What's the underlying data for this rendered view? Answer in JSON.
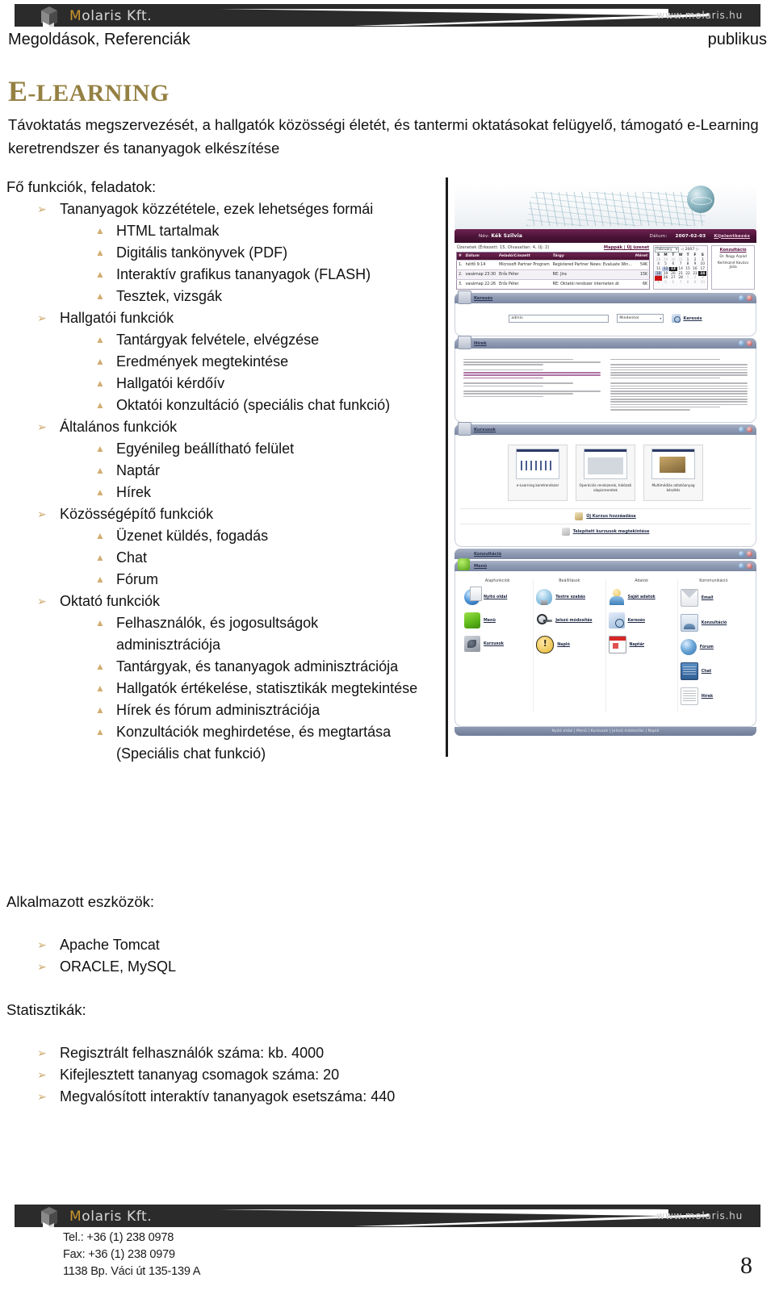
{
  "brand": {
    "name_accent": "M",
    "name_rest": "olaris Kft.",
    "url": "www.molaris.hu"
  },
  "page_head": {
    "left": "Megoldások, Referenciák",
    "right": "publikus"
  },
  "title": {
    "first_letter": "E",
    "rest": "-LEARNING"
  },
  "intro": "Távoktatás megszervezését, a hallgatók közösségi életét, és tantermi oktatásokat felügyelő, támogató e-Learning keretrendszer és tananyagok elkészítése",
  "sections": {
    "functions_label": "Fő funkciók, feladatok:",
    "groups": [
      {
        "label": "Tananyagok közzététele, ezek lehetséges formái",
        "items": [
          "HTML tartalmak",
          "Digitális tankönyvek (PDF)",
          "Interaktív grafikus tananyagok (FLASH)",
          "Tesztek, vizsgák"
        ]
      },
      {
        "label": "Hallgatói funkciók",
        "items": [
          "Tantárgyak felvétele, elvégzése",
          "Eredmények megtekintése",
          "Hallgatói kérdőív",
          "Oktatói konzultáció (speciális chat funkció)"
        ]
      },
      {
        "label": "Általános funkciók",
        "items": [
          "Egyénileg beállítható felület",
          "Naptár",
          "Hírek"
        ]
      },
      {
        "label": "Közösségépítő funkciók",
        "items": [
          "Üzenet küldés, fogadás",
          "Chat",
          "Fórum"
        ]
      },
      {
        "label": "Oktató funkciók",
        "items": [
          "Felhasználók, és jogosultságok adminisztrációja",
          "Tantárgyak, és tananyagok adminisztrációja",
          "Hallgatók értékelése, statisztikák megtekintése",
          "Hírek és fórum adminisztrációja",
          "Konzultációk meghirdetése, és megtartása (Speciális chat funkció)"
        ]
      }
    ],
    "tools_label": "Alkalmazott eszközök:",
    "tools": [
      "Apache Tomcat",
      "ORACLE, MySQL"
    ],
    "stats_label": "Statisztikák:",
    "stats": [
      "Regisztrált felhasználók száma: kb. 4000",
      "Kifejlesztett tananyag csomagok száma: 20",
      "Megvalósított interaktív tananyagok esetszáma: 440"
    ]
  },
  "bullets": {
    "level1_glyph": "➢",
    "level2_glyph": "▲"
  },
  "screenshot": {
    "userbar": {
      "name_label": "Név:",
      "name_value": "Kék Szilvia",
      "date_label": "Dátum:",
      "date_value": "2007-02-03",
      "logout": "Kijelentkezés"
    },
    "messages": {
      "summary": "Üzenetek (Érkezett: 15, Olvasatlan: 4, Új: 2)",
      "links": "Mappák | Új üzenet",
      "columns": [
        "#",
        "Dátum",
        "Feladó/Címzett",
        "Tárgy",
        "Méret"
      ],
      "rows": [
        {
          "n": "1.",
          "date": "hétfő 9:14",
          "from": "Microsoft Partner Program",
          "subject": "Registered Partner News: Evaluate Win...",
          "size": "54K"
        },
        {
          "n": "2.",
          "date": "vasárnap 23:30",
          "from": "Erős Péter",
          "subject": "RE: Jira",
          "size": "15K"
        },
        {
          "n": "3.",
          "date": "vasárnap 22:26",
          "from": "Erős Péter",
          "subject": "RE: Oktatói rendszer interneten át",
          "size": "6K"
        }
      ]
    },
    "calendar": {
      "month": "February",
      "year": "2007",
      "prev": "◁",
      "next": "▷",
      "weekdays": [
        "S",
        "M",
        "T",
        "W",
        "T",
        "F",
        "S"
      ],
      "weeks": [
        [
          "28",
          "29",
          "30",
          "31",
          "1",
          "2",
          "3"
        ],
        [
          "4",
          "5",
          "6",
          "7",
          "8",
          "9",
          "10"
        ],
        [
          "11",
          "12",
          "13",
          "14",
          "15",
          "16",
          "17"
        ],
        [
          "18",
          "19",
          "20",
          "21",
          "22",
          "23",
          "24"
        ],
        [
          "25",
          "26",
          "27",
          "28",
          "1",
          "2",
          "3"
        ],
        [
          "4",
          "5",
          "6",
          "7",
          "8",
          "9",
          "10"
        ]
      ],
      "selected_day": "13",
      "today_day": "24"
    },
    "konzultacio": {
      "title": "Konzultáció",
      "names": [
        "Dr. Nagy Árpád",
        "Kertészné Kovács Júlia"
      ]
    },
    "panels": {
      "search_title": "Keresés",
      "news_title": "Hírek",
      "courses_title": "Kurzusok",
      "konzultacio_title": "Konzultáció",
      "menu_title": "Menü"
    },
    "search": {
      "value": "admin",
      "scope": "Mindenhol",
      "button": "Keresés"
    },
    "courses": {
      "cards": [
        "e-Learning keretrendszer",
        "Operációs rendszerek, hálózati alapismeretek",
        "Multimédiás oktatóanyag készítés"
      ],
      "add_link": "Új Kurzus hozzáadása",
      "view_link": "Telepített kurzusok megtekintése"
    },
    "menu": {
      "columns": [
        {
          "title": "Alapfunkciók",
          "items": [
            {
              "label": "Nyitó oldal",
              "icon": "globe-icon"
            },
            {
              "label": "Menü",
              "icon": "cube-icon"
            },
            {
              "label": "Kurzusok",
              "icon": "courses-icon"
            }
          ]
        },
        {
          "title": "Beállítások",
          "items": [
            {
              "label": "Testre szabás",
              "icon": "bulb-icon"
            },
            {
              "label": "Jelszó módosítás",
              "icon": "key-icon"
            },
            {
              "label": "Napló",
              "icon": "warning-icon"
            }
          ]
        },
        {
          "title": "Adatok",
          "items": [
            {
              "label": "Saját adatok",
              "icon": "user-icon"
            },
            {
              "label": "Keresés",
              "icon": "search-icon"
            },
            {
              "label": "Naptár",
              "icon": "calendar-icon"
            }
          ]
        },
        {
          "title": "Kommunikáció",
          "items": [
            {
              "label": "Email",
              "icon": "mail-icon"
            },
            {
              "label": "Konzultáció",
              "icon": "consultation-icon"
            },
            {
              "label": "Fórum",
              "icon": "forum-icon"
            },
            {
              "label": "Chat",
              "icon": "chat-icon"
            },
            {
              "label": "Hírek",
              "icon": "news-icon"
            }
          ]
        }
      ]
    },
    "footbar": "Nyitó oldal | Menü | Kurzusok | Jelszó módosítás | Napló"
  },
  "footer": {
    "tel": "Tel.: +36 (1) 238 0978",
    "fax": "Fax: +36 (1) 238 0979",
    "address": "1138 Bp. Váci út 135-139 A",
    "page_number": "8"
  },
  "colors": {
    "title_gold": "#948042",
    "bullet_gold": "#cba76a",
    "bar_dark": "#2b2b2b",
    "app_purple": "#4c1438"
  }
}
